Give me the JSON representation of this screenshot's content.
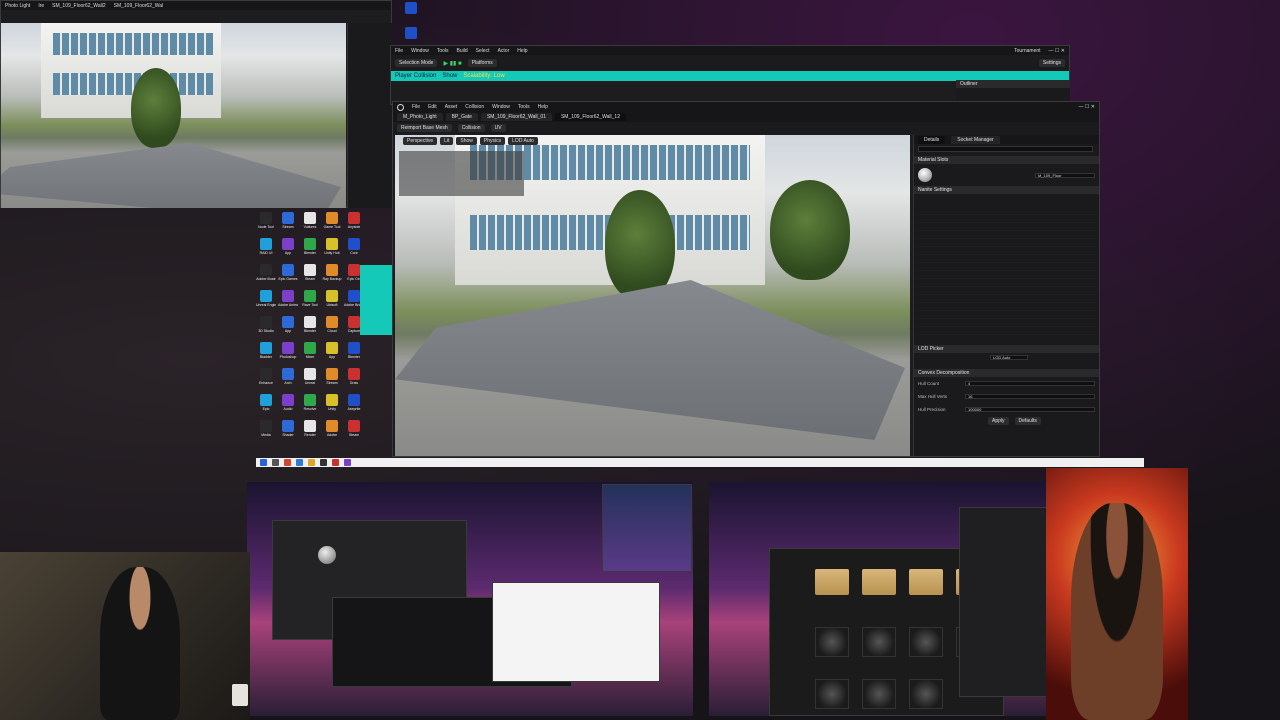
{
  "top_left_editor": {
    "title_items": [
      "Photo Light",
      "Ire",
      "SM_109_Floor62_Wall2",
      "SM_109_Floor62_Wal"
    ]
  },
  "main_editor": {
    "mode_button": "Selection Mode",
    "platforms": "Platforms",
    "settings": "Settings",
    "outliner": "Outliner",
    "tournament": "Tournament",
    "top_menu": [
      "File",
      "Window",
      "Tools",
      "Build",
      "Select",
      "Actor",
      "Help"
    ],
    "status_items": [
      "Player Collision",
      "Show",
      "Scalability: Low"
    ]
  },
  "mesh_editor": {
    "menu": [
      "File",
      "Edit",
      "Asset",
      "Collision",
      "Window",
      "Tools",
      "Help"
    ],
    "tabs": [
      "M_Photo_Light",
      "BP_Gate",
      "SM_109_Floor62_Wall_01",
      "SM_109_Floor62_Wall_12"
    ],
    "toolbar": [
      "Reimport Base Mesh",
      "Collision",
      "UV"
    ],
    "viewport_buttons": [
      "Perspective",
      "Lit",
      "Show",
      "Physics",
      "LOD Auto"
    ],
    "details_tab": "Details",
    "socket_tab": "Socket Manager",
    "section_material": "Material Slots",
    "section_nanite": "Nanite Settings",
    "section_lod": "LOD Picker",
    "material_name": "M_109_Floor",
    "convex_title": "Convex Decomposition",
    "hull_count_label": "Hull Count",
    "hull_count_value": "4",
    "max_hull_label": "Max Hull Verts",
    "max_hull_value": "16",
    "hull_precision_label": "Hull Precision",
    "hull_precision_value": "100000",
    "apply_button": "Apply",
    "defaults_button": "Defaults",
    "lod_value": "LOD Auto"
  },
  "desktop_icons": [
    "Node Tool",
    "Stream",
    "Vultures",
    "Game Tool",
    "Anyside",
    "RAID UI",
    "App",
    "Blender",
    "Unity Hub",
    "Core",
    "Adobe Illustr",
    "Epic Games",
    "Steam",
    "Ray Backup",
    "Epic Ctrl",
    "Unreal Engine",
    "Adobe Animate",
    "Rave Tool",
    "Ubisoft",
    "Adobe Bridge",
    "3D Studio",
    "App",
    "Blender",
    "Cloud",
    "Capture",
    "Bladder",
    "Photoshop",
    "Mixer",
    "App",
    "Blender",
    "Enhance",
    "Arch",
    "Unreal",
    "Stream",
    "Draw",
    "Epic",
    "Audio",
    "Resolve",
    "Unity",
    "Aseprite",
    "Media",
    "Shader",
    "Render",
    "Adobe",
    "Steam"
  ],
  "colors": {
    "accent_green": "#38d46b",
    "teal": "#14c9b8",
    "editor_bg": "#1d1d1f"
  }
}
